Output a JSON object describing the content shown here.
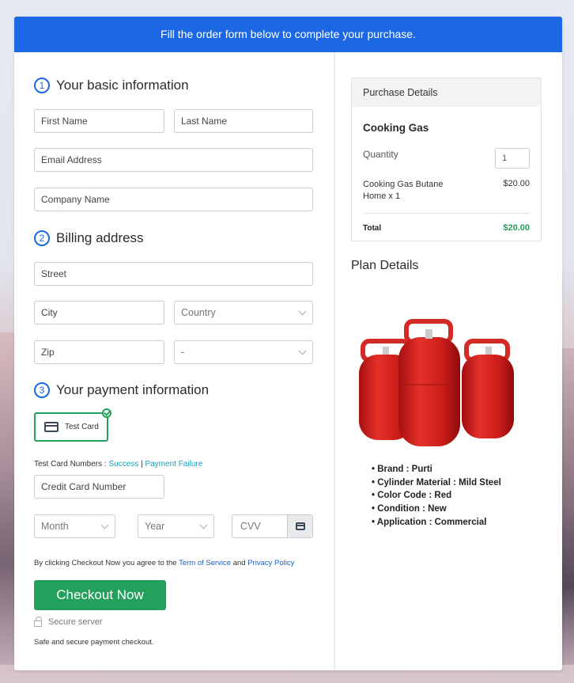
{
  "banner": {
    "text": "Fill the order form below to complete your purchase."
  },
  "sections": {
    "basic": {
      "number": "1",
      "title": "Your basic information"
    },
    "billing": {
      "number": "2",
      "title": "Billing address"
    },
    "payment": {
      "number": "3",
      "title": "Your payment information"
    }
  },
  "fields": {
    "first_name": "First Name",
    "last_name": "Last Name",
    "email": "Email Address",
    "company": "Company Name",
    "street": "Street",
    "city": "City",
    "country": "Country",
    "zip": "Zip",
    "state": "-",
    "card_number": "Credit Card Number",
    "month": "Month",
    "year": "Year",
    "cvv": "CVV"
  },
  "payment": {
    "method_label": "Test Card",
    "test_numbers_label": "Test Card Numbers :",
    "success_link": "Success",
    "separator": "|",
    "failure_link": "Payment Failure"
  },
  "agreement": {
    "prefix": "By clicking Checkout Now you agree to the",
    "terms_link": "Term of Service",
    "and": "and",
    "privacy_link": "Privacy Policy"
  },
  "checkout": {
    "button_label": "Checkout Now",
    "secure_label": "Secure server",
    "safe_text": "Safe and secure payment checkout."
  },
  "purchase": {
    "header": "Purchase Details",
    "product": "Cooking Gas",
    "quantity_label": "Quantity",
    "quantity_value": "1",
    "item_line1": "Cooking Gas Butane",
    "item_line2": "Home x 1",
    "item_price": "$20.00",
    "total_label": "Total",
    "total_value": "$20.00"
  },
  "plan": {
    "title": "Plan Details",
    "image_alt": "three red gas cylinders",
    "features": [
      "Brand : Purti",
      "Cylinder Material : Mild Steel",
      "Color Code : Red",
      "Condition : New",
      "Application : Commercial"
    ]
  },
  "colors": {
    "brand_blue": "#1c68e4",
    "success_green": "#22a05c",
    "link_teal": "#19a0b5",
    "link_blue": "#1a5fc4"
  }
}
